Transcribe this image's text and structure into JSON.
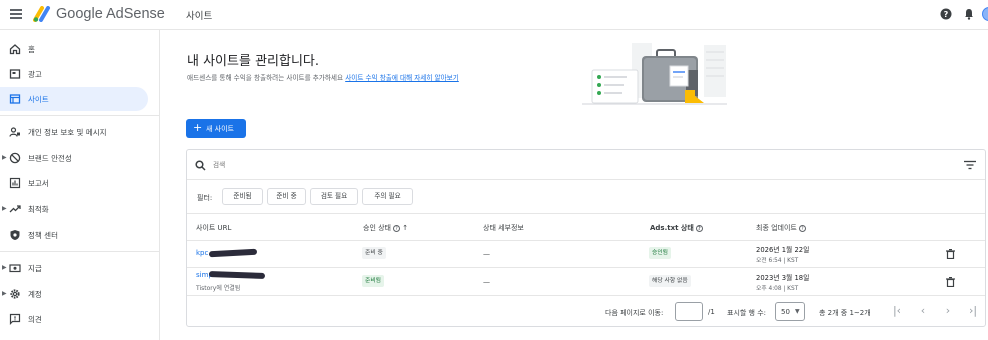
{
  "header": {
    "brand_google": "Google",
    "brand_product": "AdSense",
    "page_title": "사이트",
    "help_icon": "help-icon",
    "bell_icon": "notifications-icon"
  },
  "sidebar": {
    "items": [
      {
        "label": "홈",
        "icon": "home-icon"
      },
      {
        "label": "광고",
        "icon": "ads-icon"
      },
      {
        "label": "사이트",
        "icon": "sites-icon",
        "active": true
      },
      {
        "label": "개인 정보 보호 및 메시지",
        "icon": "privacy-icon"
      },
      {
        "label": "브랜드 안전성",
        "icon": "block-icon"
      },
      {
        "label": "보고서",
        "icon": "reports-icon"
      },
      {
        "label": "최적화",
        "icon": "trending-icon"
      },
      {
        "label": "정책 센터",
        "icon": "policy-icon"
      },
      {
        "label": "지급",
        "icon": "payments-icon"
      },
      {
        "label": "계정",
        "icon": "gear-icon"
      },
      {
        "label": "의견",
        "icon": "feedback-icon"
      }
    ]
  },
  "main": {
    "heading": "내 사이트를 관리합니다.",
    "subtext": "애드센스를 통해 수익을 창출하려는 사이트를 추가하세요",
    "subtext_link": "사이트 수익 창출에 대해 자세히 알아보기",
    "new_site_button": "새 사이트",
    "search_placeholder": "검색",
    "filter_label": "필터:",
    "filter_chips": [
      "준비됨",
      "준비 중",
      "검토 필요",
      "주의 필요"
    ],
    "columns": {
      "site_url": "사이트 URL",
      "approval": "승인 상태",
      "detail": "상태 세부정보",
      "ads_txt": "Ads.txt 상태",
      "last_update": "최종 업데이트"
    },
    "rows": [
      {
        "url": "kpc...",
        "sub": "",
        "approval": "준비 중",
        "detail": "—",
        "ads_txt": "승인됨",
        "date": "2026년 1월 22일",
        "time": "오전 6:54 | KST"
      },
      {
        "url": "simp...",
        "sub": "Tistory에 연결됨",
        "approval": "준비됨",
        "detail": "—",
        "ads_txt": "해당 사항 없음",
        "date": "2023년 3월 18일",
        "time": "오후 4:08 | KST"
      }
    ],
    "footer": {
      "goto_label": "다음 페이지로 이동:",
      "page_value": "",
      "page_total": "/1",
      "rows_label": "표시할 행 수:",
      "rows_value": "50",
      "range_text": "총 2개 중 1~2개"
    }
  },
  "colors": {
    "accent": "#1a73e8",
    "active_bg": "#e8f0fe",
    "green_badge": "#e6f4ea"
  }
}
